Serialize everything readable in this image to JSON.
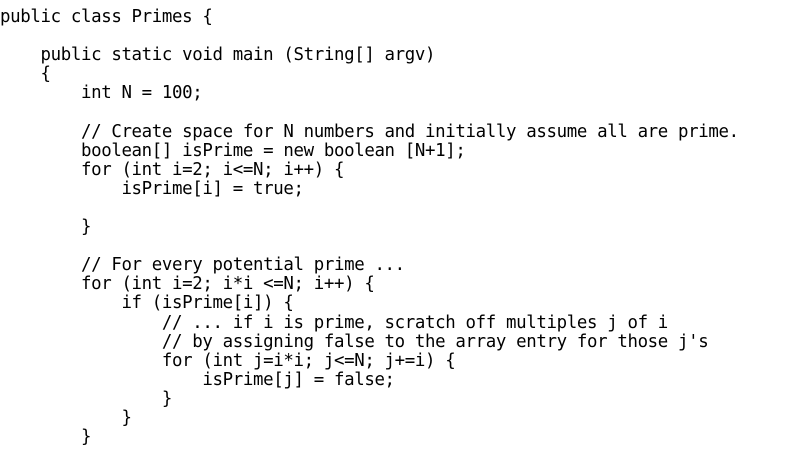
{
  "code": {
    "lines": [
      "public class Primes {",
      "",
      "    public static void main (String[] argv)",
      "    {",
      "        int N = 100;",
      "",
      "        // Create space for N numbers and initially assume all are prime.",
      "        boolean[] isPrime = new boolean [N+1];",
      "        for (int i=2; i<=N; i++) {",
      "            isPrime[i] = true;",
      "",
      "        }",
      "",
      "        // For every potential prime ...",
      "        for (int i=2; i*i <=N; i++) {",
      "            if (isPrime[i]) {",
      "                // ... if i is prime, scratch off multiples j of i",
      "                // by assigning false to the array entry for those j's",
      "                for (int j=i*i; j<=N; j+=i) {",
      "                    isPrime[j] = false;",
      "                }",
      "            }",
      "        }"
    ]
  }
}
